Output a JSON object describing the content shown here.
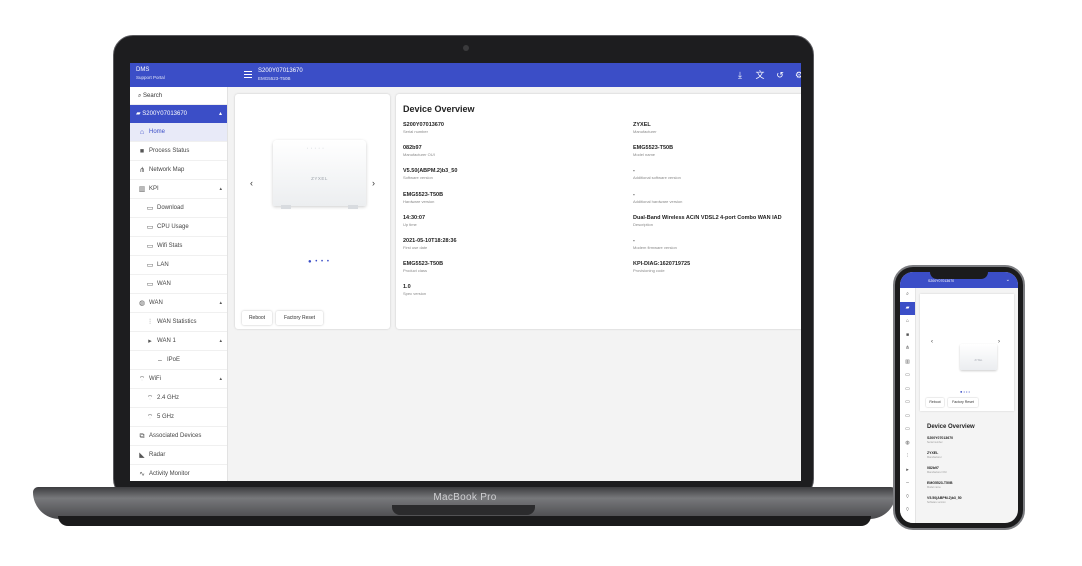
{
  "laptop": {
    "brand_label": "MacBook Pro",
    "app": {
      "brand": {
        "title": "DMS",
        "subtitle": "Support Portal"
      },
      "device_header": {
        "serial": "S200Y07013670",
        "subtitle": "EMG5523-T50B"
      },
      "topbar_icons": [
        "download-icon",
        "translate-icon",
        "history-icon",
        "gear-icon"
      ],
      "search_placeholder": "Search",
      "device_item": "S200Y07013670",
      "nav": [
        {
          "label": "Home",
          "icon": "home-icon",
          "active": true
        },
        {
          "label": "Process Status",
          "icon": "process-icon"
        },
        {
          "label": "Network Map",
          "icon": "network-map-icon"
        },
        {
          "label": "KPI",
          "icon": "kpi-icon",
          "expanded": true
        },
        {
          "label": "Download",
          "icon": "chart-window-icon",
          "sub": true
        },
        {
          "label": "CPU Usage",
          "icon": "chart-window-icon",
          "sub": true
        },
        {
          "label": "Wifi Stats",
          "icon": "chart-window-icon",
          "sub": true
        },
        {
          "label": "LAN",
          "icon": "chart-window-icon",
          "sub": true
        },
        {
          "label": "WAN",
          "icon": "chart-window-icon",
          "sub": true
        },
        {
          "label": "WAN",
          "icon": "globe-icon",
          "expanded": true
        },
        {
          "label": "WAN Statistics",
          "icon": "bar-chart-icon",
          "sub": true
        },
        {
          "label": "WAN 1",
          "icon": "caret-right-icon",
          "sub": true,
          "expanded": true
        },
        {
          "label": "IPoE",
          "icon": "dash-icon",
          "subsub": true
        },
        {
          "label": "WiFi",
          "icon": "wifi-icon",
          "expanded": true
        },
        {
          "label": "2.4 GHz",
          "icon": "wifi-icon",
          "sub": true
        },
        {
          "label": "5 GHz",
          "icon": "wifi-icon",
          "sub": true
        },
        {
          "label": "Associated Devices",
          "icon": "devices-icon"
        },
        {
          "label": "Radar",
          "icon": "radar-icon"
        },
        {
          "label": "Activity Monitor",
          "icon": "activity-icon"
        }
      ],
      "carousel": {
        "router_brand": "ZYXEL"
      },
      "buttons": {
        "reboot": "Reboot",
        "factory_reset": "Factory Reset"
      },
      "overview": {
        "title": "Device Overview",
        "left": [
          {
            "value": "S200Y07013670",
            "label": "Serial number"
          },
          {
            "value": "082b97",
            "label": "Manufacturer OUI"
          },
          {
            "value": "V5.50(ABPM.2)b3_50",
            "label": "Software version"
          },
          {
            "value": "EMG5523-T50B",
            "label": "Hardware version"
          },
          {
            "value": "14:30:07",
            "label": "Up time"
          },
          {
            "value": "2021-05-10T18:28:36",
            "label": "First use date"
          },
          {
            "value": "EMG5523-T50B",
            "label": "Product class"
          },
          {
            "value": "1.0",
            "label": "Spec version"
          }
        ],
        "right": [
          {
            "value": "ZYXEL",
            "label": "Manufacturer"
          },
          {
            "value": "EMG5523-T50B",
            "label": "Model name"
          },
          {
            "value": "-",
            "label": "Additional software version"
          },
          {
            "value": "-",
            "label": "Additional hardware version"
          },
          {
            "value": "Dual-Band Wireless AC/N VDSL2 4-port Combo WAN IAD",
            "label": "Description"
          },
          {
            "value": "-",
            "label": "Modem firmware version"
          },
          {
            "value": "KPI-DIAG:1620719725",
            "label": "Provisioning code"
          }
        ]
      }
    }
  },
  "phone": {
    "header": "S200Y07013670",
    "router_brand": "ZYXEL",
    "buttons": {
      "reboot": "Reboot",
      "factory_reset": "Factory Reset"
    },
    "overview_title": "Device Overview",
    "fields": [
      {
        "value": "S200Y07013670",
        "label": "Serial number"
      },
      {
        "value": "ZYXEL",
        "label": "Manufacturer"
      },
      {
        "value": "082b97",
        "label": "Manufacturer OUI"
      },
      {
        "value": "EMG5523-T50B",
        "label": "Model name"
      },
      {
        "value": "V5.50(ABPM.2)b3_50",
        "label": "Software version"
      }
    ]
  },
  "colors": {
    "accent": "#3b4ec7",
    "active_bg": "#e8eaf8"
  }
}
